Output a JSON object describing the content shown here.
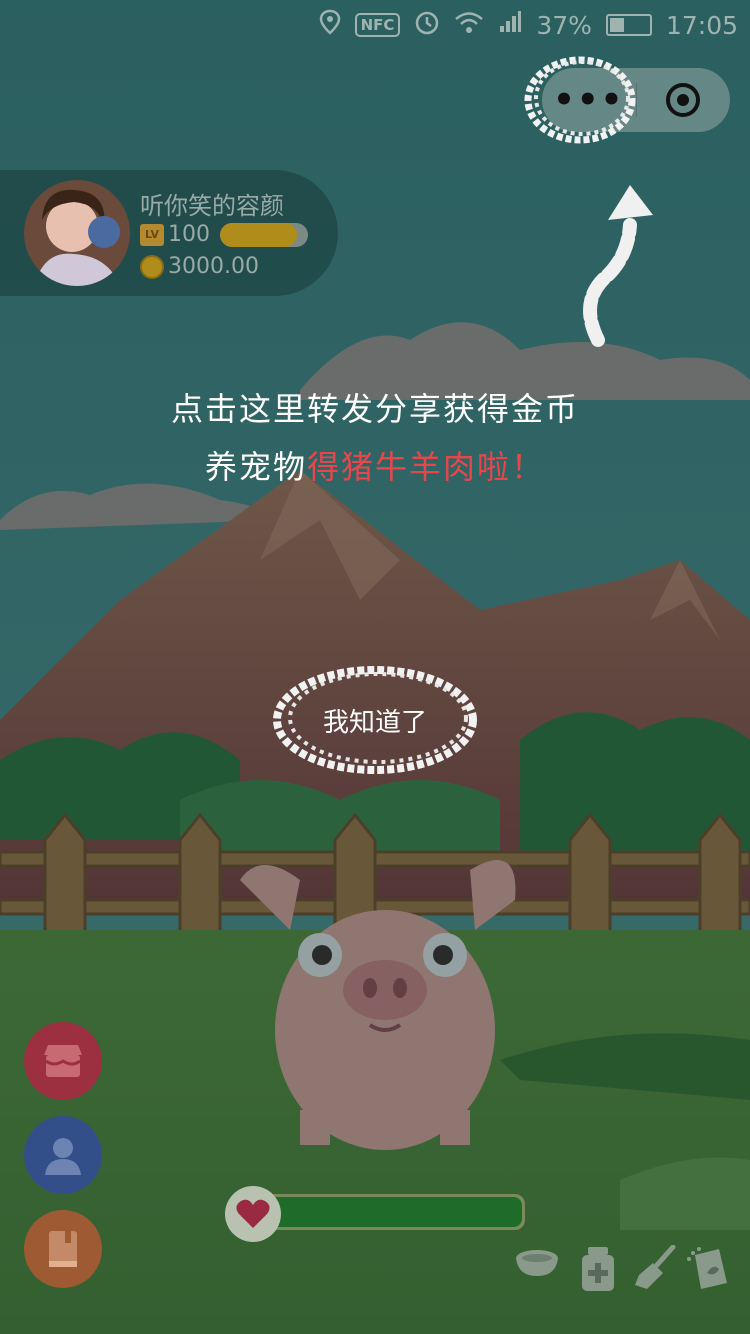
{
  "status_bar": {
    "nfc": "NFC",
    "battery_percent": "37%",
    "battery_level": 0.37,
    "time": "17:05",
    "icons": [
      "location-icon",
      "alarm-icon",
      "wifi-icon",
      "signal-icon",
      "battery-icon"
    ]
  },
  "capsule": {
    "more_label": "•••",
    "icons": [
      "more-icon",
      "close-target-icon"
    ]
  },
  "profile": {
    "name": "听你笑的容颜",
    "level_badge": "LV",
    "level": "100",
    "level_progress": 0.88,
    "coins": "3000.00"
  },
  "tip": {
    "line1": "点击这里转发分享获得金币",
    "line2_prefix": "养宠物",
    "line2_highlight": "得猪牛羊肉啦！"
  },
  "dismiss_button": "我知道了",
  "side_buttons": [
    "shop-icon",
    "user-icon",
    "book-icon"
  ],
  "health": {
    "value": 1.0,
    "icon": "heart-icon"
  },
  "tools": [
    "bowl-icon",
    "medicine-icon",
    "broom-icon",
    "seed-bag-icon"
  ],
  "colors": {
    "tip_highlight": "#e8464b",
    "shop": "#c0334a",
    "user": "#3c5ea6",
    "book": "#c46a3a",
    "health": "#1f6b2a",
    "level": "#b08d1a"
  }
}
